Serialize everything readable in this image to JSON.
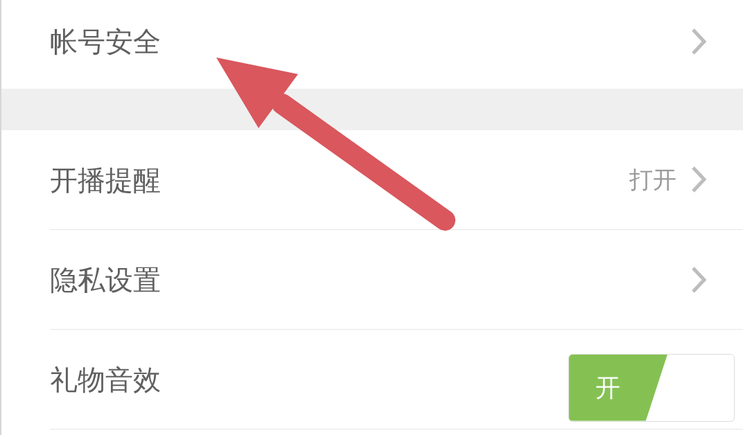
{
  "settings": {
    "groups": [
      {
        "items": [
          {
            "kind": "link",
            "label": "帐号安全"
          }
        ]
      },
      {
        "items": [
          {
            "kind": "link",
            "label": "开播提醒",
            "value": "打开"
          },
          {
            "kind": "link",
            "label": "隐私设置"
          },
          {
            "kind": "toggle",
            "label": "礼物音效",
            "on": true,
            "toggle_label": "开"
          }
        ]
      }
    ]
  },
  "overlays": [
    {
      "kind": "arrow"
    }
  ]
}
